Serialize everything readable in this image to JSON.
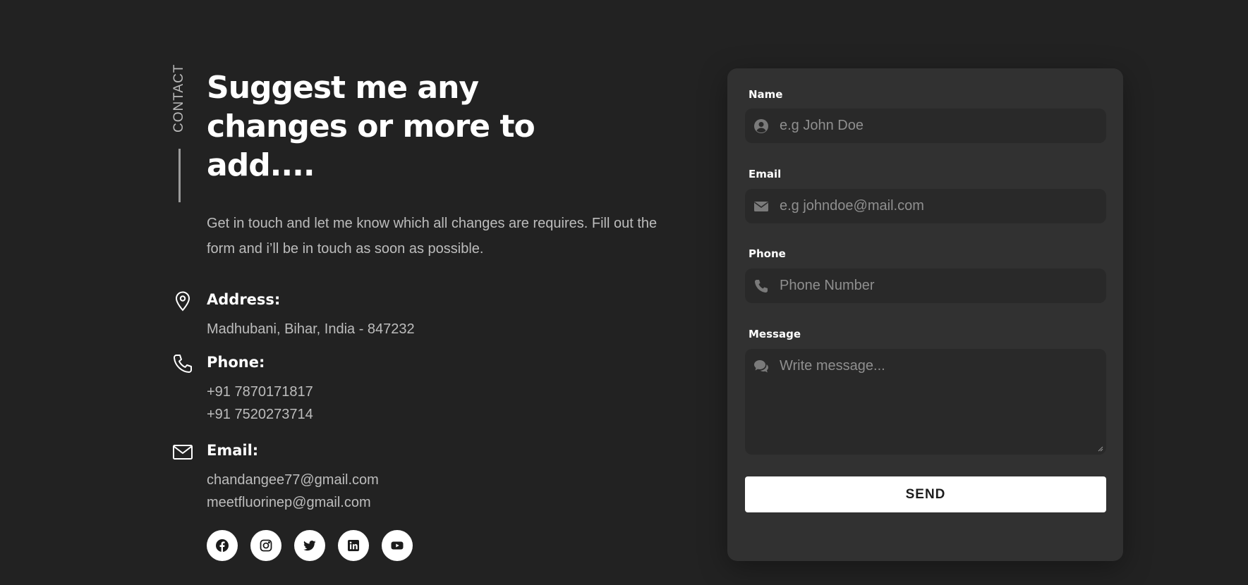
{
  "section": {
    "label": "CONTACT",
    "title": "Suggest me any changes or more to add....",
    "intro": "Get in touch and let me know which all changes are requires. Fill out the form and i’ll be in touch as soon as possible."
  },
  "info": {
    "address": {
      "icon": "map-pin-icon",
      "heading": "Address:",
      "lines": [
        "Madhubani, Bihar, India - 847232"
      ]
    },
    "phone": {
      "icon": "phone-icon",
      "heading": "Phone:",
      "lines": [
        "+91 7870171817",
        "+91 7520273714"
      ]
    },
    "email": {
      "icon": "envelope-icon",
      "heading": "Email:",
      "lines": [
        "chandangee77@gmail.com",
        "meetfluorinep@gmail.com"
      ]
    }
  },
  "socials": [
    {
      "name": "facebook-icon"
    },
    {
      "name": "instagram-icon"
    },
    {
      "name": "twitter-icon"
    },
    {
      "name": "linkedin-icon"
    },
    {
      "name": "youtube-icon"
    }
  ],
  "form": {
    "name": {
      "label": "Name",
      "placeholder": "e.g John Doe",
      "value": "",
      "icon": "user-circle-icon"
    },
    "email": {
      "label": "Email",
      "placeholder": "e.g johndoe@mail.com",
      "value": "",
      "icon": "envelope-icon"
    },
    "phone": {
      "label": "Phone",
      "placeholder": "Phone Number",
      "value": "",
      "icon": "phone-icon"
    },
    "message": {
      "label": "Message",
      "placeholder": "Write message...",
      "value": "",
      "icon": "chat-bubbles-icon"
    },
    "send_label": "SEND"
  },
  "colors": {
    "background": "#222222",
    "card": "#313131",
    "input": "#292929",
    "text_muted": "#bdbdbd",
    "button": "#ffffff"
  }
}
